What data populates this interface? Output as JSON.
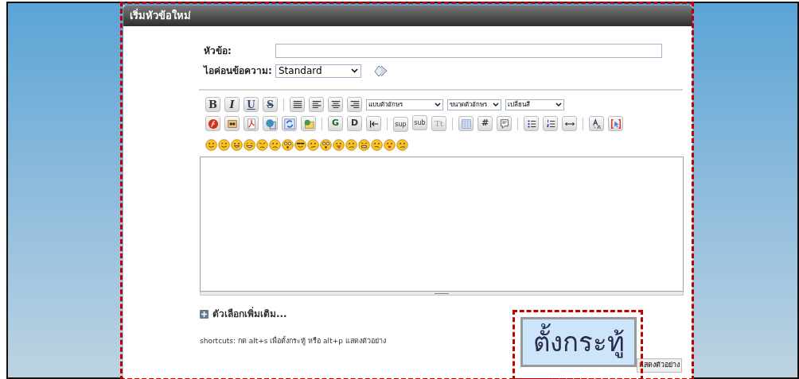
{
  "panel": {
    "title": "เริ่มหัวข้อใหม่"
  },
  "form": {
    "subject_label": "หัวข้อ:",
    "icon_label": "ไอค่อนข้อความ:",
    "icon_select": "Standard"
  },
  "toolbar_row_1": [
    {
      "kind": "bold",
      "glyph": "B"
    },
    {
      "kind": "italic",
      "glyph": "I"
    },
    {
      "kind": "underline",
      "glyph": "U"
    },
    {
      "kind": "strike",
      "glyph": "S"
    },
    {
      "kind": "separator"
    },
    {
      "kind": "justify"
    },
    {
      "kind": "align-left"
    },
    {
      "kind": "align-center"
    },
    {
      "kind": "align-right"
    },
    {
      "kind": "select",
      "value": "แบบตัวอักษร"
    },
    {
      "kind": "select",
      "value": "ขนาดตัวอักษร"
    },
    {
      "kind": "select",
      "value": "เปลี่ยนสี"
    }
  ],
  "toolbar_row_2": [
    {
      "kind": "flash"
    },
    {
      "kind": "image"
    },
    {
      "kind": "pdf"
    },
    {
      "kind": "globe"
    },
    {
      "kind": "refresh"
    },
    {
      "kind": "folder"
    },
    {
      "kind": "separator"
    },
    {
      "kind": "green",
      "glyph": "G"
    },
    {
      "kind": "plain",
      "glyph": "D"
    },
    {
      "kind": "indent"
    },
    {
      "kind": "separator"
    },
    {
      "kind": "sup",
      "glyph": "sup"
    },
    {
      "kind": "sub",
      "glyph": "sub"
    },
    {
      "kind": "faint",
      "glyph": "Tt"
    },
    {
      "kind": "separator"
    },
    {
      "kind": "table"
    },
    {
      "kind": "plain",
      "glyph": "#"
    },
    {
      "kind": "quote"
    },
    {
      "kind": "separator"
    },
    {
      "kind": "bullets"
    },
    {
      "kind": "numbers"
    },
    {
      "kind": "hr"
    },
    {
      "kind": "separator"
    },
    {
      "kind": "case"
    },
    {
      "kind": "cursor"
    }
  ],
  "smileys": [
    {
      "kind": "smile"
    },
    {
      "kind": "wink"
    },
    {
      "kind": "grin"
    },
    {
      "kind": "laugh"
    },
    {
      "kind": "angry"
    },
    {
      "kind": "sad"
    },
    {
      "kind": "eek"
    },
    {
      "kind": "cool"
    },
    {
      "kind": "confused"
    },
    {
      "kind": "eek"
    },
    {
      "kind": "tongue"
    },
    {
      "kind": "cry"
    },
    {
      "kind": "mad"
    },
    {
      "kind": "frown"
    },
    {
      "kind": "kiss"
    },
    {
      "kind": "cry"
    }
  ],
  "more_options": "ตัวเลือกเพิ่มเติม...",
  "shortcuts": "shortcuts: กด alt+s เพื่อตั้งกระทู้ หรือ alt+p แสดงตัวอย่าง",
  "submit_button": "ตั้งกระทู้",
  "preview_button": "แสดงตัวอย่าง"
}
